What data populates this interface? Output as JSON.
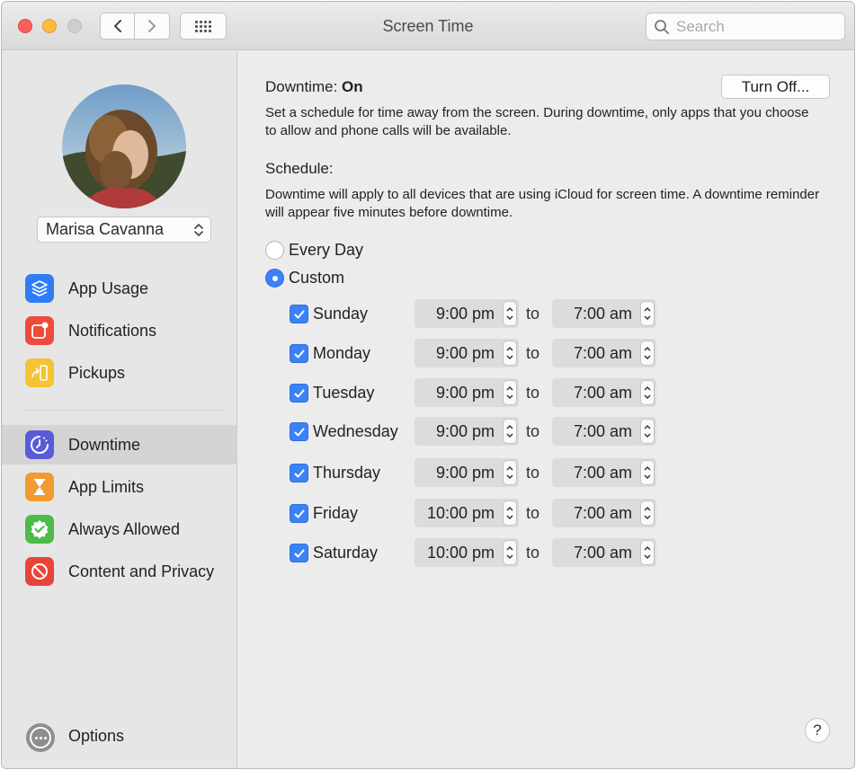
{
  "window": {
    "title": "Screen Time",
    "search": {
      "placeholder": "Search",
      "value": ""
    }
  },
  "sidebar": {
    "user": "Marisa Cavanna",
    "items": [
      {
        "label": "App Usage",
        "icon": "app-usage-icon",
        "color": "#2f7cf6"
      },
      {
        "label": "Notifications",
        "icon": "notifications-icon",
        "color": "#ef4a3c"
      },
      {
        "label": "Pickups",
        "icon": "pickups-icon",
        "color": "#f5c333"
      },
      {
        "label": "Downtime",
        "icon": "downtime-icon",
        "color": "#5a5bd8",
        "selected": true
      },
      {
        "label": "App Limits",
        "icon": "hourglass-icon",
        "color": "#f19a30"
      },
      {
        "label": "Always Allowed",
        "icon": "checkmark-badge-icon",
        "color": "#4cbb4a"
      },
      {
        "label": "Content and Privacy",
        "icon": "restricted-icon",
        "color": "#e8453a"
      }
    ],
    "options_label": "Options"
  },
  "main": {
    "downtime_label": "Downtime:",
    "downtime_status": "On",
    "turn_off_button": "Turn Off...",
    "description": "Set a schedule for time away from the screen. During downtime, only apps that you choose to allow and phone calls will be available.",
    "schedule_heading": "Schedule:",
    "schedule_description": "Downtime will apply to all devices that are using iCloud for screen time. A downtime reminder will appear five minutes before downtime.",
    "options": [
      {
        "label": "Every Day",
        "selected": false
      },
      {
        "label": "Custom",
        "selected": true
      }
    ],
    "to_label": "to",
    "days": [
      {
        "day": "Sunday",
        "checked": true,
        "from": "9:00 pm",
        "to": "7:00 am"
      },
      {
        "day": "Monday",
        "checked": true,
        "from": "9:00 pm",
        "to": "7:00 am"
      },
      {
        "day": "Tuesday",
        "checked": true,
        "from": "9:00 pm",
        "to": "7:00 am"
      },
      {
        "day": "Wednesday",
        "checked": true,
        "from": "9:00 pm",
        "to": "7:00 am"
      },
      {
        "day": "Thursday",
        "checked": true,
        "from": "9:00 pm",
        "to": "7:00 am"
      },
      {
        "day": "Friday",
        "checked": true,
        "from": "10:00 pm",
        "to": "7:00 am"
      },
      {
        "day": "Saturday",
        "checked": true,
        "from": "10:00 pm",
        "to": "7:00 am"
      }
    ],
    "help_label": "?"
  }
}
